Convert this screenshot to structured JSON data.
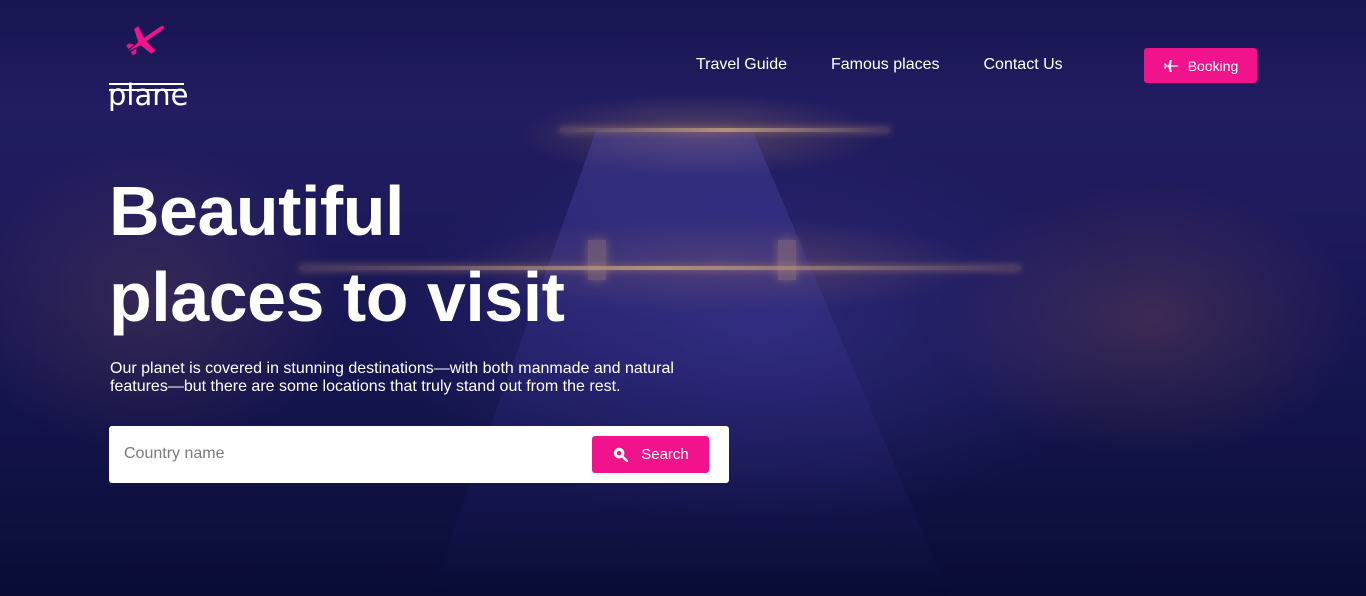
{
  "brand": {
    "name": "plane",
    "accent_color": "#f0138b"
  },
  "nav": {
    "items": [
      {
        "label": "Travel Guide"
      },
      {
        "label": "Famous places"
      },
      {
        "label": "Contact Us"
      }
    ],
    "booking_label": "Booking",
    "booking_icon": "airplane-icon"
  },
  "hero": {
    "headline_line1": "Beautiful",
    "headline_line2": "places to visit",
    "subtitle": "Our planet is covered in stunning destinations—with both manmade and natural features—but there are some locations that truly stand out from the rest."
  },
  "search": {
    "placeholder": "Country name",
    "value": "",
    "button_label": "Search",
    "button_icon": "search-icon"
  }
}
